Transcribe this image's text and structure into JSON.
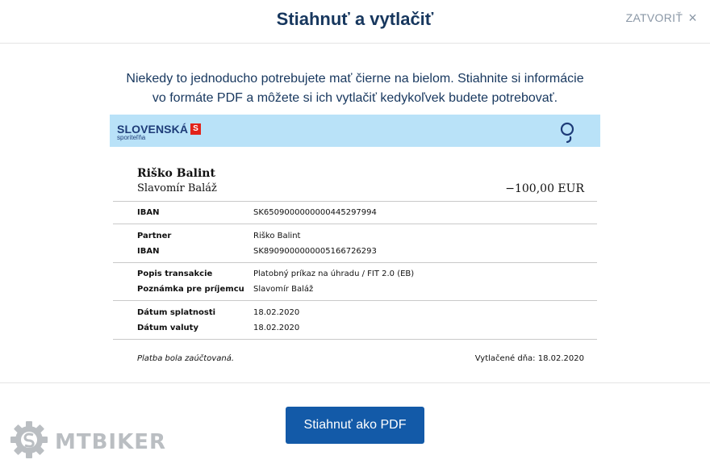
{
  "header": {
    "title": "Stiahnuť a vytlačiť",
    "close_label": "ZATVORIŤ",
    "close_icon": "×"
  },
  "intro": {
    "line1": "Niekedy to jednoducho potrebujete mať čierne na bielom. Stiahnite si informácie",
    "line2": "vo formáte PDF a môžete si ich vytlačiť kedykoľvek budete potrebovať."
  },
  "document": {
    "logo": {
      "name": "SLOVENSKÁ",
      "sub": "sporiteľňa",
      "mark": "S"
    },
    "brand_color": "#b9e2f8",
    "recipient_name": "Riško Balint",
    "sender_name": "Slavomír Baláž",
    "amount": "−100,00 EUR",
    "rows": [
      {
        "label": "IBAN",
        "value": "SK6509000000000445297994"
      },
      {
        "label": "Partner",
        "value": "Riško Balint"
      },
      {
        "label": "IBAN",
        "value": "SK8909000000005166726293"
      },
      {
        "label": "Popis transakcie",
        "value": "Platobný príkaz na úhradu / FIT 2.0 (EB)"
      },
      {
        "label": "Poznámka pre príjemcu",
        "value": "Slavomír Baláž"
      },
      {
        "label": "Dátum splatnosti",
        "value": "18.02.2020"
      },
      {
        "label": "Dátum valuty",
        "value": "18.02.2020"
      }
    ],
    "footer_status": "Platba bola zaúčtovaná.",
    "footer_printed": "Vytlačené dňa: 18.02.2020"
  },
  "actions": {
    "download_pdf": "Stiahnuť ako PDF",
    "accent_color": "#135aa8"
  },
  "watermark": {
    "text": "MTBIKER"
  }
}
